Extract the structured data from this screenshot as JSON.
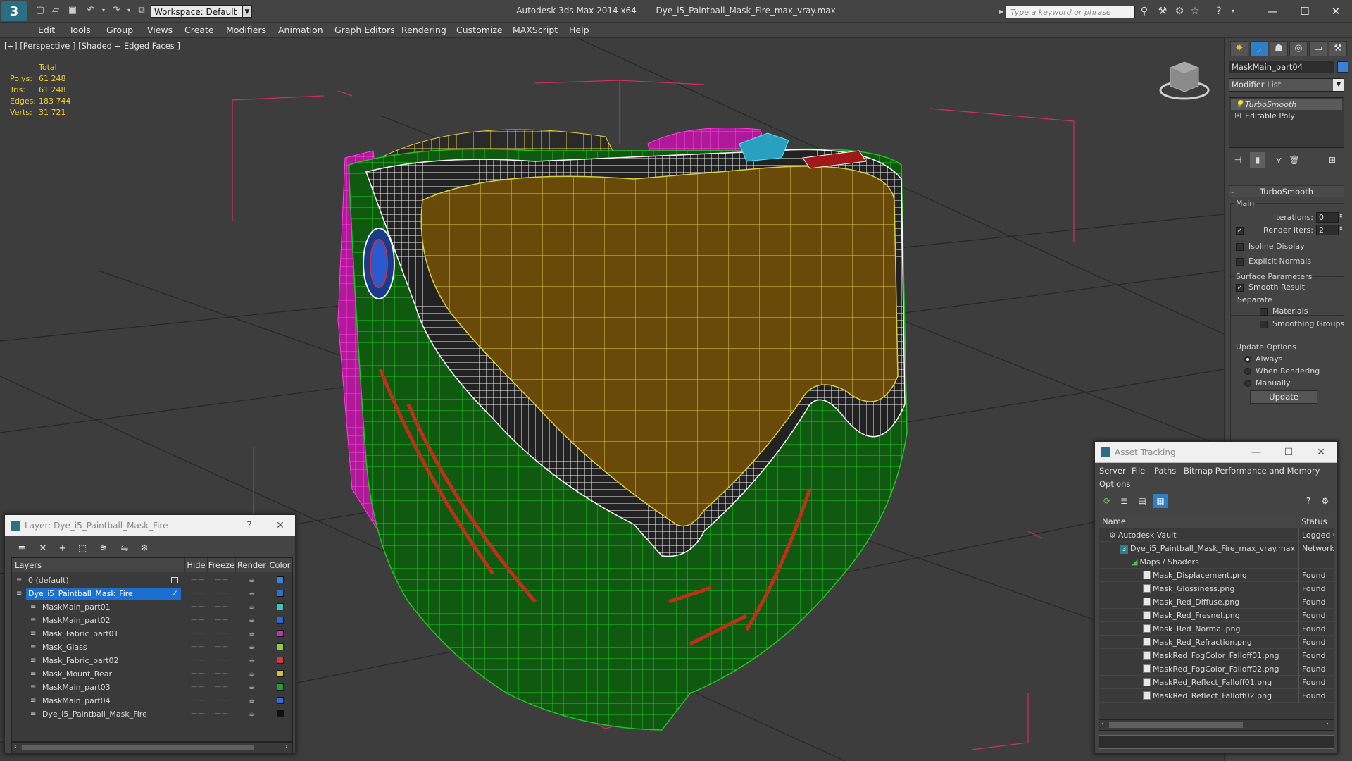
{
  "app": {
    "title": "Autodesk 3ds Max  2014 x64",
    "file_name": "Dye_i5_Paintball_Mask_Fire_max_vray.max",
    "logo_letter": "3",
    "workspace": "Workspace: Default",
    "search_placeholder": "Type a keyword or phrase"
  },
  "menu": [
    "Edit",
    "Tools",
    "Group",
    "Views",
    "Create",
    "Modifiers",
    "Animation",
    "Graph Editors",
    "Rendering",
    "Customize",
    "MAXScript",
    "Help"
  ],
  "viewport": {
    "label": "[+] [Perspective ] [Shaded + Edged Faces ]",
    "stats": {
      "header": "Total",
      "rows": [
        {
          "label": "Polys:",
          "value": "61 248"
        },
        {
          "label": "Tris:",
          "value": "61 248"
        },
        {
          "label": "Edges:",
          "value": "183 744"
        },
        {
          "label": "Verts:",
          "value": "31 721"
        }
      ]
    }
  },
  "command_panel": {
    "object_name": "MaskMain_part04",
    "object_color": "#3a82d8",
    "modifier_list": "Modifier List",
    "stack": [
      "TurboSmooth",
      "Editable Poly"
    ],
    "rollout_title": "TurboSmooth",
    "main_group": "Main",
    "iterations_label": "Iterations:",
    "iterations_value": "0",
    "render_iters_label": "Render Iters:",
    "render_iters_value": "2",
    "render_iters_checked": true,
    "isoline_display": "Isoline Display",
    "explicit_normals": "Explicit Normals",
    "surface_group": "Surface Parameters",
    "smooth_result": "Smooth Result",
    "separate_label": "Separate",
    "materials": "Materials",
    "smoothing_groups": "Smoothing Groups",
    "update_group": "Update Options",
    "always": "Always",
    "when_rendering": "When Rendering",
    "manually": "Manually",
    "update_button": "Update"
  },
  "layer_window": {
    "title": "Layer: Dye_i5_Paintball_Mask_Fire",
    "help": "?",
    "columns": [
      "Layers",
      "Hide",
      "Freeze",
      "Render",
      "Color"
    ],
    "rows": [
      {
        "name": "0 (default)",
        "color": "#3a82d8",
        "level": 0,
        "selected": false
      },
      {
        "name": "Dye_i5_Paintball_Mask_Fire",
        "color": "#2f6fd0",
        "level": 0,
        "selected": true
      },
      {
        "name": "MaskMain_part01",
        "color": "#36c8b8",
        "level": 1,
        "selected": false
      },
      {
        "name": "MaskMain_part02",
        "color": "#2a6ad0",
        "level": 1,
        "selected": false
      },
      {
        "name": "Mask_Fabric_part01",
        "color": "#c030b0",
        "level": 1,
        "selected": false
      },
      {
        "name": "Mask_Glass",
        "color": "#8ad040",
        "level": 1,
        "selected": false
      },
      {
        "name": "Mask_Fabric_part02",
        "color": "#d03848",
        "level": 1,
        "selected": false
      },
      {
        "name": "Mask_Mount_Rear",
        "color": "#d8c030",
        "level": 1,
        "selected": false
      },
      {
        "name": "MaskMain_part03",
        "color": "#20a030",
        "level": 1,
        "selected": false
      },
      {
        "name": "MaskMain_part04",
        "color": "#3a6ad8",
        "level": 1,
        "selected": false
      },
      {
        "name": "Dye_i5_Paintball_Mask_Fire",
        "color": "#111111",
        "level": 1,
        "selected": false
      }
    ]
  },
  "asset_window": {
    "title": "Asset Tracking",
    "menu": [
      "Server",
      "File",
      "Paths",
      "Bitmap Performance and Memory",
      "Options"
    ],
    "columns": [
      "Name",
      "Status"
    ],
    "rows": [
      {
        "name": "Autodesk Vault",
        "status": "Logged Out",
        "level": 0,
        "icon": "vault"
      },
      {
        "name": "Dye_i5_Paintball_Mask_Fire_max_vray.max",
        "status": "Network",
        "level": 1,
        "icon": "max"
      },
      {
        "name": "Maps / Shaders",
        "status": "",
        "level": 2,
        "icon": "maps"
      },
      {
        "name": "Mask_Displacement.png",
        "status": "Found",
        "level": 3,
        "icon": "file"
      },
      {
        "name": "Mask_Glossiness.png",
        "status": "Found",
        "level": 3,
        "icon": "file"
      },
      {
        "name": "Mask_Red_Diffuse.png",
        "status": "Found",
        "level": 3,
        "icon": "file"
      },
      {
        "name": "Mask_Red_Fresnel.png",
        "status": "Found",
        "level": 3,
        "icon": "file"
      },
      {
        "name": "Mask_Red_Normal.png",
        "status": "Found",
        "level": 3,
        "icon": "file"
      },
      {
        "name": "Mask_Red_Refraction.png",
        "status": "Found",
        "level": 3,
        "icon": "file"
      },
      {
        "name": "MaskRed_FogColor_Falloff01.png",
        "status": "Found",
        "level": 3,
        "icon": "file"
      },
      {
        "name": "MaskRed_FogColor_Falloff02.png",
        "status": "Found",
        "level": 3,
        "icon": "file"
      },
      {
        "name": "MaskRed_Reflect_Falloff01.png",
        "status": "Found",
        "level": 3,
        "icon": "file"
      },
      {
        "name": "MaskRed_Reflect_Falloff02.png",
        "status": "Found",
        "level": 3,
        "icon": "file"
      }
    ]
  },
  "colors": {
    "selection": "#1a6fd0",
    "stats_text": "#f0d030",
    "visor": "#6a4a08",
    "shell_green": "#0f5a10",
    "wire_yellow": "#d8d040"
  }
}
